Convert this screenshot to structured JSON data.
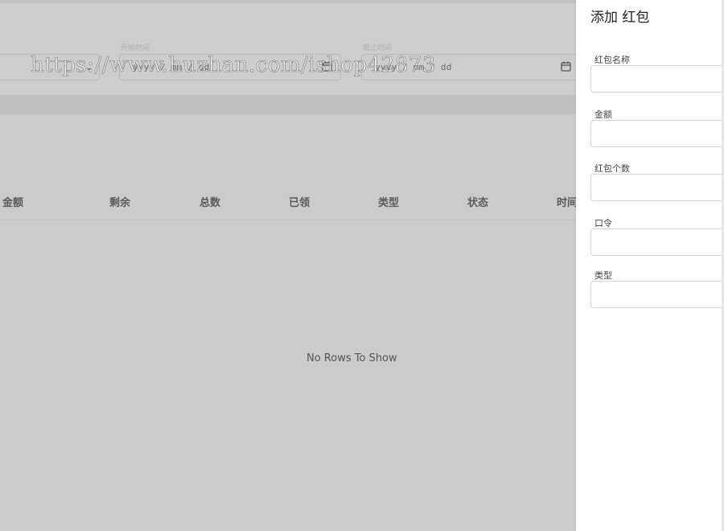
{
  "filters": {
    "select_chevron": "chevron-down-icon",
    "start_date_label": "开始时间",
    "end_date_label": "截止时间",
    "start_date_placeholder": "yyyy / mm / dd",
    "end_date_placeholder": "yyyy / mm / dd",
    "calendar_icon": "calendar-icon"
  },
  "watermark": "https://www.huzhan.com/ishop42873",
  "grid": {
    "columns": [
      "金额",
      "剩余",
      "总数",
      "已领",
      "类型",
      "状态",
      "时间"
    ],
    "empty_message": "No Rows To Show"
  },
  "drawer": {
    "title": "添加 红包",
    "fields": [
      {
        "label": "红包名称",
        "value": ""
      },
      {
        "label": "金额",
        "value": ""
      },
      {
        "label": "红包个数",
        "value": ""
      },
      {
        "label": "口令",
        "value": ""
      },
      {
        "label": "类型",
        "value": ""
      }
    ]
  }
}
